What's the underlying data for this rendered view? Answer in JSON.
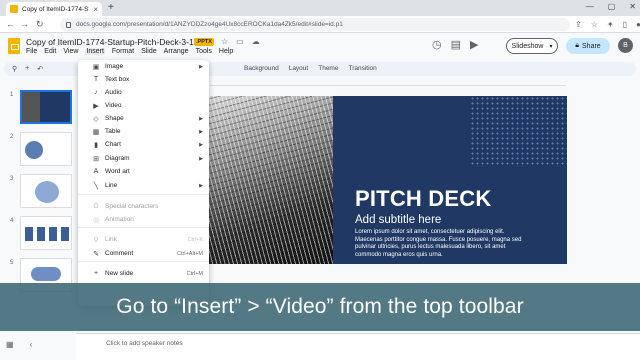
{
  "browser": {
    "tab_title": "Copy of ItemID-1774-Startup-...",
    "new_tab": "+",
    "url": "docs.google.com/presentation/d/1ANZYDDZzo4ge4Ux8ccEROCKa1da4Zk5/edit#slide=id.p1",
    "window_controls": [
      "—",
      "▢",
      "✕"
    ]
  },
  "app": {
    "doc_title": "Copy of ItemID-1774-Startup-Pitch-Deck-3-16x9",
    "file_badge": ".PPTX",
    "menus": [
      "File",
      "Edit",
      "View",
      "Insert",
      "Format",
      "Slide",
      "Arrange",
      "Tools",
      "Help"
    ],
    "slideshow_label": "Slideshow",
    "share_label": "Share",
    "avatar_initial": "B"
  },
  "toolbar": {
    "items": [
      "Background",
      "Layout",
      "Theme",
      "Transition"
    ]
  },
  "insert_menu": {
    "items": [
      {
        "icon": "image-icon",
        "glyph": "▣",
        "label": "Image",
        "submenu": true
      },
      {
        "icon": "textbox-icon",
        "glyph": "T",
        "label": "Text box"
      },
      {
        "icon": "audio-icon",
        "glyph": "♪",
        "label": "Audio"
      },
      {
        "icon": "video-icon",
        "glyph": "▶",
        "label": "Video"
      },
      {
        "icon": "shape-icon",
        "glyph": "◇",
        "label": "Shape",
        "submenu": true
      },
      {
        "icon": "table-icon",
        "glyph": "▦",
        "label": "Table",
        "submenu": true
      },
      {
        "icon": "chart-icon",
        "glyph": "▮",
        "label": "Chart",
        "submenu": true
      },
      {
        "icon": "diagram-icon",
        "glyph": "⊞",
        "label": "Diagram",
        "submenu": true
      },
      {
        "icon": "wordart-icon",
        "glyph": "A",
        "label": "Word art"
      },
      {
        "icon": "line-icon",
        "glyph": "╲",
        "label": "Line",
        "submenu": true
      },
      {
        "icon": "special-characters-icon",
        "glyph": "Ω",
        "label": "Special characters",
        "disabled": true
      },
      {
        "icon": "animation-icon",
        "glyph": "◎",
        "label": "Animation",
        "disabled": true
      },
      {
        "icon": "link-icon",
        "glyph": "⚲",
        "label": "Link",
        "shortcut": "Ctrl+K",
        "disabled": true
      },
      {
        "icon": "comment-icon",
        "glyph": "✎",
        "label": "Comment",
        "shortcut": "Ctrl+Alt+M"
      },
      {
        "icon": "new-slide-icon",
        "glyph": "+",
        "label": "New slide",
        "shortcut": "Ctrl+M"
      }
    ]
  },
  "slide": {
    "title": "PITCH DECK",
    "subtitle": "Add subtitle here",
    "body": "Lorem ipsum dolor sit amet, consectetuer adipiscing elit. Maecenas porttitor congue massa. Fusce posuere, magna sed pulvinar ultricies, purus lectus malesuada libero, sit amet commodo magna eros quis urna."
  },
  "filmstrip": {
    "slide_numbers": [
      "1",
      "2",
      "3",
      "4",
      "5"
    ]
  },
  "notes": {
    "placeholder": "Click to add speaker notes"
  },
  "caption": {
    "text": "Go to “Insert” > “Video” from the top toolbar"
  },
  "colors": {
    "slide_panel": "#1f3864",
    "caption_bg": "#3a6673",
    "accent": "#1a73e8"
  }
}
